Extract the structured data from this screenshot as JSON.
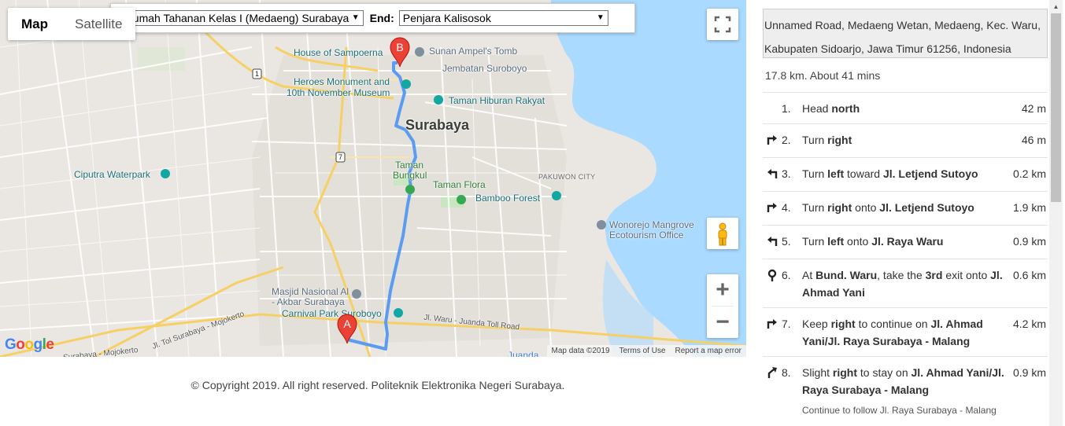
{
  "map": {
    "type_tabs": [
      "Map",
      "Satellite"
    ],
    "active_tab": "Map",
    "start_label": ":",
    "start_value": "Rumah Tahanan Kelas I (Medaeng) Surabaya",
    "end_label": "End:",
    "end_value": "Penjara Kalisosok",
    "marker_a": "A",
    "marker_b": "B",
    "labels": {
      "house_sampoerna": "House of Sampoerna",
      "sunan_ampel": "Sunan Ampel's Tomb",
      "jembatan": "Jembatan Suroboyo",
      "heroes_1": "Heroes Monument and",
      "heroes_2": "10th November Museum",
      "taman_hiburan": "Taman Hiburan Rakyat",
      "surabaya": "Surabaya",
      "ciputra": "Ciputra Waterpark",
      "pakuwon": "PAKUWON CITY",
      "taman_bungkul_1": "Taman",
      "taman_bungkul_2": "Bungkul",
      "taman_flora": "Taman Flora",
      "bamboo": "Bamboo Forest",
      "wonorejo_1": "Wonorejo Mangrove",
      "wonorejo_2": "Ecotourism Office",
      "masjid_1": "Masjid Nasional Al",
      "masjid_2": "- Akbar Surabaya",
      "carnival": "Carnival Park Suroboyo",
      "juanda": "Jl. Waru - Juanda Toll Road",
      "juanda_bottom": "Juanda",
      "tol_mojokerto": "Jl. Tol Surabaya - Mojokerto",
      "mojokerto_bottom": "Surabaya - Mojokerto",
      "route_1": "1",
      "route_7": "7"
    },
    "attribution": [
      "Map data ©2019",
      "Terms of Use",
      "Report a map error"
    ],
    "logo": "Google"
  },
  "footer": "© Copyright 2019. All right reserved. Politeknik Elektronika Negeri Surabaya.",
  "directions": {
    "address": "Unnamed Road, Medaeng Wetan, Medaeng, Kec. Waru, Kabupaten Sidoarjo, Jawa Timur 61256, Indonesia",
    "summary": "17.8 km. About 41 mins",
    "steps": [
      {
        "num": "1.",
        "icon": "none",
        "html": "Head <b>north</b>",
        "dist": "42 m"
      },
      {
        "num": "2.",
        "icon": "turn-right-icon",
        "html": "Turn <b>right</b>",
        "dist": "46 m"
      },
      {
        "num": "3.",
        "icon": "turn-left-icon",
        "html": "Turn <b>left</b> toward <b>Jl. Letjend Sutoyo</b>",
        "dist": "0.2 km"
      },
      {
        "num": "4.",
        "icon": "turn-right-icon",
        "html": "Turn <b>right</b> onto <b>Jl. Letjend Sutoyo</b>",
        "dist": "1.9 km"
      },
      {
        "num": "5.",
        "icon": "turn-left-icon",
        "html": "Turn <b>left</b> onto <b>Jl. Raya Waru</b>",
        "dist": "0.9 km"
      },
      {
        "num": "6.",
        "icon": "roundabout-icon",
        "html": "At <b>Bund. Waru</b>, take the <b>3rd</b> exit onto <b>Jl. Ahmad Yani</b>",
        "dist": "0.6 km"
      },
      {
        "num": "7.",
        "icon": "turn-right-icon",
        "html": "Keep <b>right</b> to continue on <b>Jl. Ahmad Yani/Jl. Raya Surabaya - Malang</b>",
        "dist": "4.2 km"
      },
      {
        "num": "8.",
        "icon": "slight-right-icon",
        "html": "Slight <b>right</b> to stay on <b>Jl. Ahmad Yani/Jl. Raya Surabaya - Malang</b>",
        "dist": "0.9 km",
        "note": "Continue to follow Jl. Raya Surabaya - Malang"
      }
    ]
  },
  "colors": {
    "route": "#5b9cf0",
    "water": "#aadaff",
    "marker": "#ea4335"
  }
}
